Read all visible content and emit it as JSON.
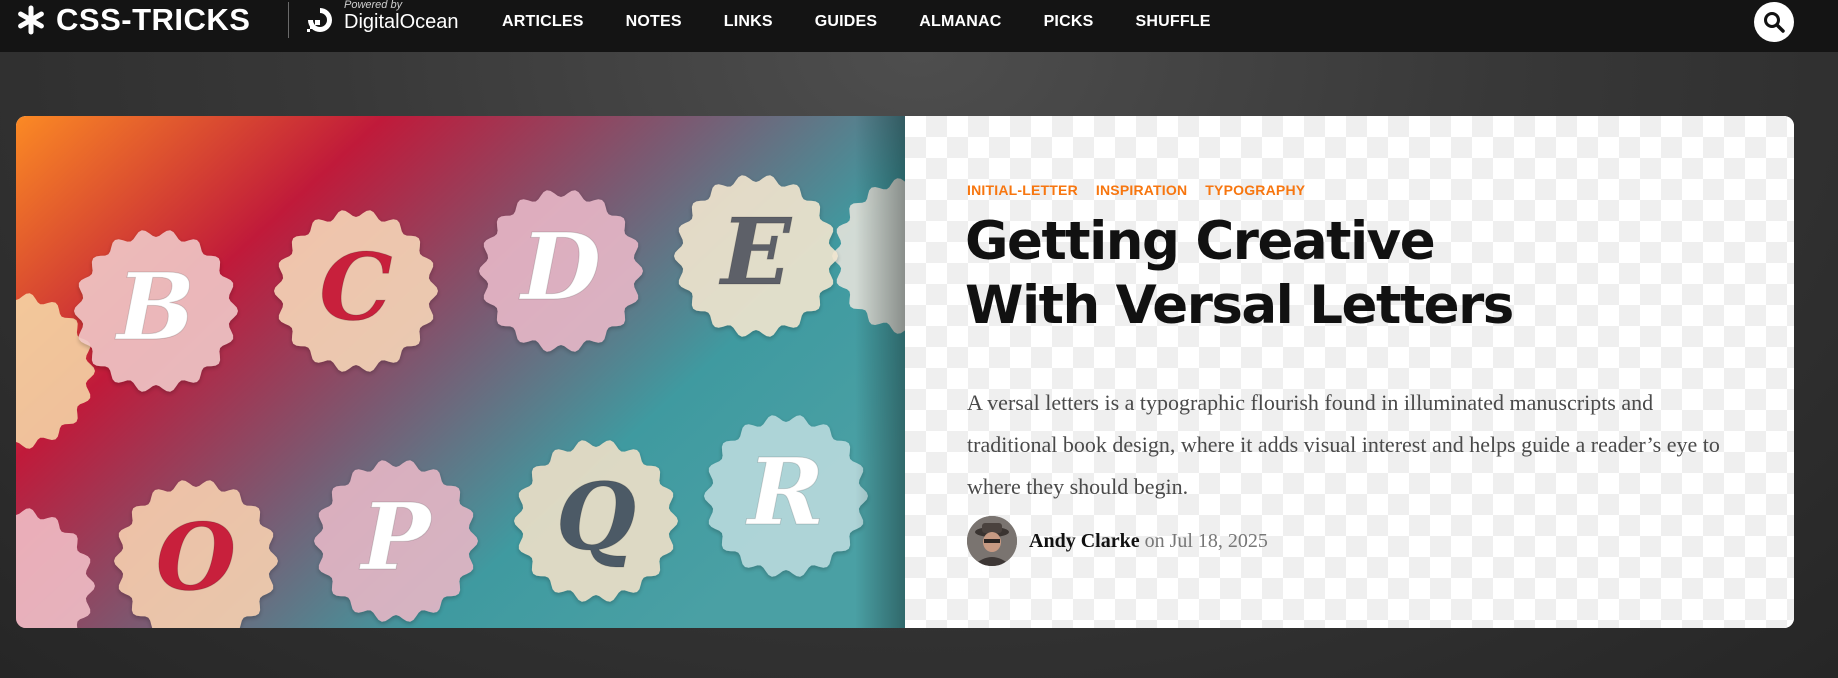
{
  "header": {
    "logo_text": "CSS-TRICKS",
    "powered_by": "Powered by",
    "sponsor": "DigitalOcean",
    "nav": [
      "ARTICLES",
      "NOTES",
      "LINKS",
      "GUIDES",
      "ALMANAC",
      "PICKS",
      "SHUFFLE"
    ],
    "search_icon": "search-icon"
  },
  "article": {
    "tags": [
      "INITIAL-LETTER",
      "INSPIRATION",
      "TYPOGRAPHY"
    ],
    "title_line1": "Getting Creative",
    "title_line2": "With Versal Letters",
    "excerpt": "A versal letters is a typographic flourish found in illuminated manuscripts and traditional book design, where it adds visual interest and helps guide a reader’s eye to where they should begin.",
    "author": "Andy Clarke",
    "date_prefix": "on",
    "date": "Jul 18, 2025",
    "hero_letters": [
      "B",
      "C",
      "D",
      "E",
      "O",
      "P",
      "Q",
      "R"
    ]
  },
  "colors": {
    "accent": "#f7760f",
    "header_bg": "#141414",
    "title": "#111111"
  }
}
